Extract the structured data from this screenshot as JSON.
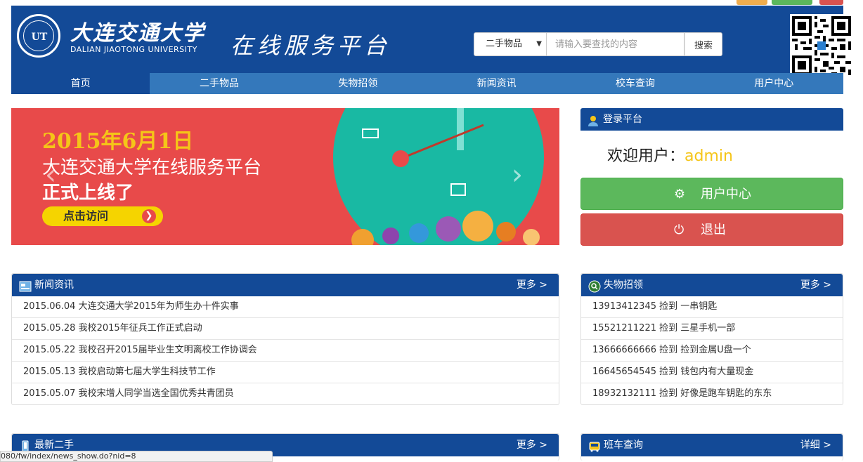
{
  "topstrip": {
    "text": ""
  },
  "header": {
    "logo_cn": "大连交通大学",
    "logo_en": "DALIAN JIAOTONG UNIVERSITY",
    "seal_text": "UT",
    "platform_title": "在线服务平台"
  },
  "search": {
    "category": "二手物品",
    "placeholder": "请输入要查找的内容",
    "button": "搜索"
  },
  "nav": {
    "items": [
      "首页",
      "二手物品",
      "失物招领",
      "新闻资讯",
      "校车查询",
      "用户中心"
    ]
  },
  "banner": {
    "date": "2015年6月1日",
    "line1": "大连交通大学在线服务平台",
    "line2": "正式上线了",
    "cta": "点击访问"
  },
  "login": {
    "title": "登录平台",
    "welcome_prefix": "欢迎用户：",
    "username": "admin",
    "user_center_button": "用户中心",
    "logout_button": "退出"
  },
  "news": {
    "title": "新闻资讯",
    "more": "更多 >",
    "items": [
      "2015.06.04 大连交通大学2015年为师生办十件实事",
      "2015.05.28 我校2015年征兵工作正式启动",
      "2015.05.22 我校召开2015届毕业生文明离校工作协调会",
      "2015.05.13 我校启动第七届大学生科技节工作",
      "2015.05.07 我校宋增人同学当选全国优秀共青团员"
    ]
  },
  "lost": {
    "title": "失物招领",
    "more": "更多 >",
    "items": [
      "13913412345 捡到 一串钥匙",
      "15521211221 捡到 三星手机一部",
      "13666666666 捡到 捡到金属U盘一个",
      "16645654545 捡到 钱包内有大量现金",
      "18932132111 捡到 好像是跑车钥匙的东东"
    ]
  },
  "secondhand": {
    "title": "最新二手",
    "more": "更多 >"
  },
  "bus": {
    "title": "班车查询",
    "more": "详细 >"
  },
  "status_tip": "080/fw/index/news_show.do?nid=8",
  "colors": {
    "primary": "#134a97",
    "nav": "#3478bb",
    "success": "#5cb85c",
    "danger": "#d9534f",
    "accent": "#f5c518"
  }
}
